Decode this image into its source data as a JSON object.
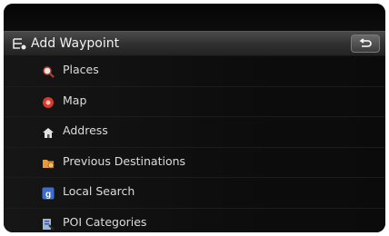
{
  "header": {
    "title": "Add Waypoint"
  },
  "menu": {
    "items": [
      {
        "label": "Places",
        "icon": "magnifier-icon"
      },
      {
        "label": "Map",
        "icon": "map-pin-icon"
      },
      {
        "label": "Address",
        "icon": "house-icon"
      },
      {
        "label": "Previous Destinations",
        "icon": "folder-icon"
      },
      {
        "label": "Local Search",
        "icon": "google-icon"
      },
      {
        "label": "POI Categories",
        "icon": "poi-icon"
      }
    ]
  },
  "colors": {
    "background": "#0b0b0b",
    "text": "#dcdcdc",
    "header": "#3a3a3a"
  }
}
